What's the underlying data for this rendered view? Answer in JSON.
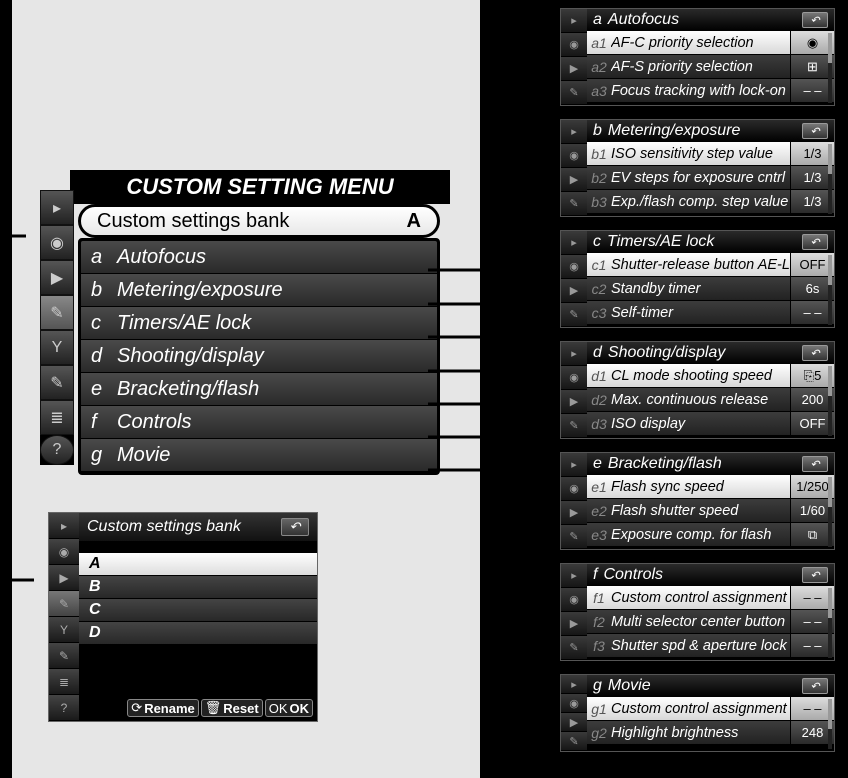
{
  "main": {
    "title": "CUSTOM SETTING MENU",
    "bank_label": "Custom settings bank",
    "bank_value": "A",
    "groups": [
      {
        "letter": "a",
        "label": "Autofocus"
      },
      {
        "letter": "b",
        "label": "Metering/exposure"
      },
      {
        "letter": "c",
        "label": "Timers/AE lock"
      },
      {
        "letter": "d",
        "label": "Shooting/display"
      },
      {
        "letter": "e",
        "label": "Bracketing/flash"
      },
      {
        "letter": "f",
        "label": "Controls"
      },
      {
        "letter": "g",
        "label": "Movie"
      }
    ]
  },
  "bank_panel": {
    "title": "Custom settings bank",
    "rows": [
      "A",
      "B",
      "C",
      "D"
    ],
    "footer": {
      "rename": "Rename",
      "reset": "Reset",
      "ok": "OK"
    }
  },
  "submenus": [
    {
      "letter": "a",
      "title": "Autofocus",
      "items": [
        {
          "n": "a1",
          "label": "AF-C priority selection",
          "val": "◉"
        },
        {
          "n": "a2",
          "label": "AF-S priority selection",
          "val": "⊞"
        },
        {
          "n": "a3",
          "label": "Focus tracking with lock-on",
          "val": "– –"
        }
      ]
    },
    {
      "letter": "b",
      "title": "Metering/exposure",
      "items": [
        {
          "n": "b1",
          "label": "ISO sensitivity step value",
          "val": "1/3"
        },
        {
          "n": "b2",
          "label": "EV steps for exposure cntrl",
          "val": "1/3"
        },
        {
          "n": "b3",
          "label": "Exp./flash comp. step value",
          "val": "1/3"
        }
      ]
    },
    {
      "letter": "c",
      "title": "Timers/AE lock",
      "items": [
        {
          "n": "c1",
          "label": "Shutter-release button AE-L",
          "val": "OFF"
        },
        {
          "n": "c2",
          "label": "Standby timer",
          "val": "6s"
        },
        {
          "n": "c3",
          "label": "Self-timer",
          "val": "– –"
        }
      ]
    },
    {
      "letter": "d",
      "title": "Shooting/display",
      "items": [
        {
          "n": "d1",
          "label": "CL mode shooting speed",
          "val": "⎘5"
        },
        {
          "n": "d2",
          "label": "Max. continuous release",
          "val": "200"
        },
        {
          "n": "d3",
          "label": "ISO display",
          "val": "OFF"
        }
      ]
    },
    {
      "letter": "e",
      "title": "Bracketing/flash",
      "items": [
        {
          "n": "e1",
          "label": "Flash sync speed",
          "val": "1/250"
        },
        {
          "n": "e2",
          "label": "Flash shutter speed",
          "val": "1/60"
        },
        {
          "n": "e3",
          "label": "Exposure comp. for flash",
          "val": "⧉"
        }
      ]
    },
    {
      "letter": "f",
      "title": "Controls",
      "items": [
        {
          "n": "f1",
          "label": "Custom control assignment",
          "val": "– –"
        },
        {
          "n": "f2",
          "label": "Multi selector center button",
          "val": "– –"
        },
        {
          "n": "f3",
          "label": "Shutter spd & aperture lock",
          "val": "– –"
        }
      ]
    },
    {
      "letter": "g",
      "title": "Movie",
      "short": true,
      "items": [
        {
          "n": "g1",
          "label": "Custom control assignment",
          "val": "– –"
        },
        {
          "n": "g2",
          "label": "Highlight brightness",
          "val": "248"
        }
      ]
    }
  ],
  "icons": {
    "play": "▸",
    "camera": "◉",
    "video": "▮",
    "pencil": "✎",
    "wrench": "🔧",
    "retouch": "✂",
    "recent": "≣",
    "help": "?",
    "back": "↶"
  }
}
